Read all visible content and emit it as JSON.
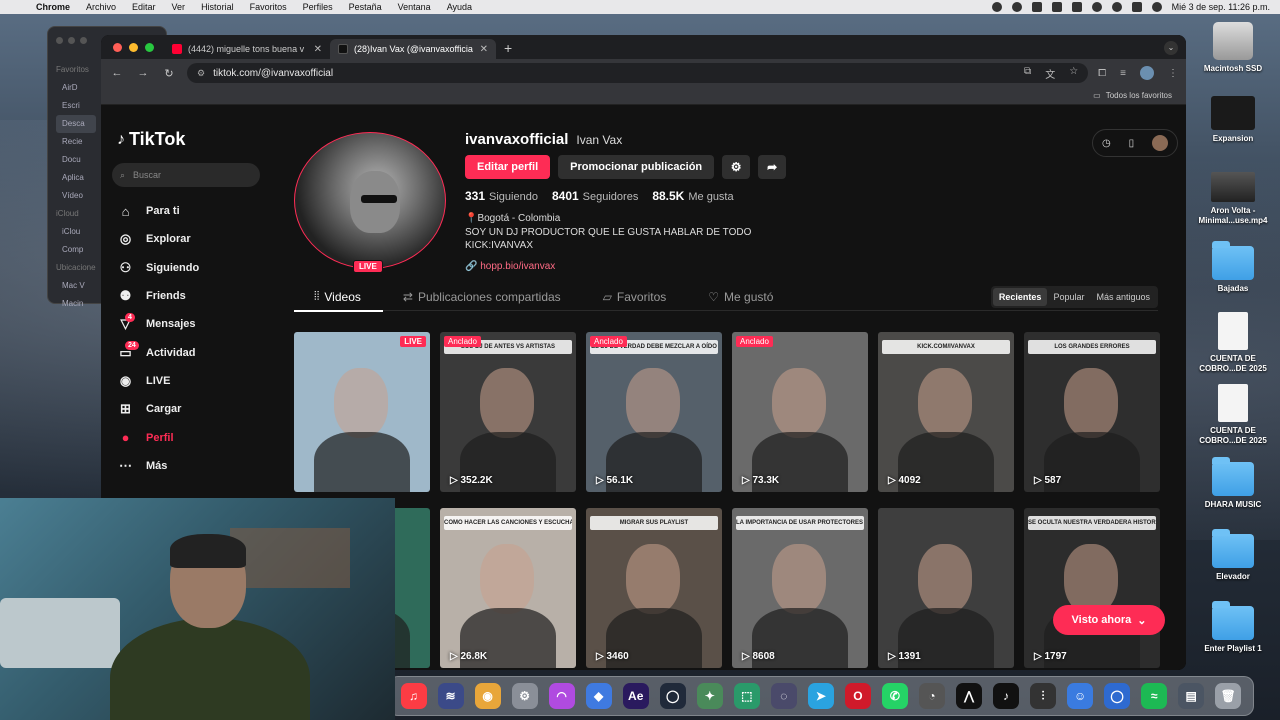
{
  "menubar": {
    "app": "Chrome",
    "items": [
      "Archivo",
      "Editar",
      "Ver",
      "Historial",
      "Favoritos",
      "Perfiles",
      "Pestaña",
      "Ventana",
      "Ayuda"
    ],
    "clock": "Mié 3 de sep.  11:26 p.m."
  },
  "finder": {
    "sections": [
      {
        "title": "Favoritos",
        "items": [
          "AirD",
          "Escri",
          "Desca",
          "Recie",
          "Docu",
          "Aplica",
          "Vídeo"
        ]
      },
      {
        "title": "iCloud",
        "items": [
          "iClou",
          "Comp"
        ]
      },
      {
        "title": "Ubicacione",
        "items": [
          "Mac V",
          "Macin"
        ]
      }
    ]
  },
  "browser": {
    "tabs": [
      {
        "title": "(4442) miguelle tons buena v",
        "favicon_color": "#ff0033"
      },
      {
        "title": "(28)Ivan Vax (@ivanvaxofficia",
        "favicon_color": "#111111"
      }
    ],
    "url": "tiktok.com/@ivanvaxofficial",
    "bookmarks_label": "Todos los favoritos"
  },
  "tiktok": {
    "logo": "TikTok",
    "search_placeholder": "Buscar",
    "nav": [
      {
        "label": "Para ti",
        "icon": "⌂",
        "name": "home-icon"
      },
      {
        "label": "Explorar",
        "icon": "◎",
        "name": "compass-icon"
      },
      {
        "label": "Siguiendo",
        "icon": "👤",
        "name": "following-icon"
      },
      {
        "label": "Friends",
        "icon": "👥",
        "name": "friends-icon"
      },
      {
        "label": "Mensajes",
        "icon": "▽",
        "name": "messages-icon",
        "badge": "4"
      },
      {
        "label": "Actividad",
        "icon": "▭",
        "name": "activity-icon",
        "badge": "24"
      },
      {
        "label": "LIVE",
        "icon": "●",
        "name": "live-icon"
      },
      {
        "label": "Cargar",
        "icon": "⊞",
        "name": "upload-icon"
      },
      {
        "label": "Perfil",
        "icon": "◉",
        "name": "profile-icon",
        "active": true
      },
      {
        "label": "Más",
        "icon": "⋯",
        "name": "more-icon"
      }
    ],
    "profile": {
      "handle": "ivanvaxofficial",
      "display_name": "Ivan Vax",
      "live_badge": "LIVE",
      "edit_button": "Editar perfil",
      "promote_button": "Promocionar publicación",
      "stats": {
        "following": "331",
        "following_label": "Siguiendo",
        "followers": "8401",
        "followers_label": "Seguidores",
        "likes": "88.5K",
        "likes_label": "Me gusta"
      },
      "bio_line1": "📍Bogotá - Colombia",
      "bio_line2": "SOY UN DJ PRODUCTOR QUE LE GUSTA HABLAR DE TODO",
      "bio_line3": "KICK:IVANVAX",
      "link": "hopp.bio/ivanvax"
    },
    "tabs": {
      "videos": "Videos",
      "reposts": "Publicaciones compartidas",
      "favorites": "Favoritos",
      "liked": "Me gustó"
    },
    "sort": {
      "recent": "Recientes",
      "popular": "Popular",
      "oldest": "Más antiguos"
    },
    "videos": [
      {
        "tag": "LIVE",
        "tag_kind": "live",
        "views": "",
        "caption": "",
        "bg": "#9fb8c9"
      },
      {
        "tag": "Anclado",
        "tag_kind": "pin",
        "views": "352.2K",
        "caption": "LOS DJ DE ANTES VS ARTISTAS",
        "bg": "#3a3a3a"
      },
      {
        "tag": "Anclado",
        "tag_kind": "pin",
        "views": "56.1K",
        "caption": "EL DJ DE VERDAD DEBE MEZCLAR A OÍDO",
        "bg": "#55606a"
      },
      {
        "tag": "Anclado",
        "tag_kind": "pin",
        "views": "73.3K",
        "caption": "",
        "bg": "#6a6a6a"
      },
      {
        "tag": "",
        "tag_kind": "",
        "views": "4092",
        "caption": "KICK.COM/IVANVAX",
        "bg": "#4b4a48"
      },
      {
        "tag": "",
        "tag_kind": "",
        "views": "587",
        "caption": "LOS GRANDES ERRORES",
        "bg": "#2e2e2e"
      },
      {
        "tag": "",
        "tag_kind": "",
        "views": "",
        "caption": "",
        "bg": "#2f6b5a"
      },
      {
        "tag": "",
        "tag_kind": "",
        "views": "26.8K",
        "caption": "COMO HACER LAS CANCIONES Y ESCUCHARLAS",
        "bg": "#b8b0a8"
      },
      {
        "tag": "",
        "tag_kind": "",
        "views": "3460",
        "caption": "MIGRAR SUS PLAYLIST",
        "bg": "#5a5048"
      },
      {
        "tag": "",
        "tag_kind": "",
        "views": "8608",
        "caption": "LA IMPORTANCIA DE USAR PROTECTORES AUDITIVOS",
        "bg": "#6a6a6a"
      },
      {
        "tag": "",
        "tag_kind": "",
        "views": "1391",
        "caption": "",
        "bg": "#3e3e3e"
      },
      {
        "tag": "",
        "tag_kind": "",
        "views": "1797",
        "caption": "SE OCULTA NUESTRA VERDADERA HISTORIA",
        "bg": "#2c2c2c"
      }
    ],
    "visto_ahora": "Visto ahora"
  },
  "desktop_icons": [
    {
      "label": "Macintosh SSD",
      "kind": "drive"
    },
    {
      "label": "Expansion",
      "kind": "ext"
    },
    {
      "label": "Aron Volta - Minimal...use.mp4",
      "kind": "thumb"
    },
    {
      "label": "Bajadas",
      "kind": "folder"
    },
    {
      "label": "CUENTA DE COBRO...DE 2025",
      "kind": "doc"
    },
    {
      "label": "CUENTA DE COBRO...DE 2025",
      "kind": "doc"
    },
    {
      "label": "DHARA MUSIC",
      "kind": "folder"
    },
    {
      "label": "Elevador",
      "kind": "folder"
    },
    {
      "label": "Enter Playlist 1",
      "kind": "folder"
    }
  ],
  "dock": [
    {
      "name": "music-app",
      "color": "#fc3c44",
      "glyph": "♫"
    },
    {
      "name": "voice-app",
      "color": "#3b4a88",
      "glyph": "≋"
    },
    {
      "name": "chrome-app",
      "color": "#e8a63a",
      "glyph": "◉"
    },
    {
      "name": "settings-app",
      "color": "#8a8f98",
      "glyph": "⚙"
    },
    {
      "name": "podcasts-app",
      "color": "#b04be0",
      "glyph": "◠"
    },
    {
      "name": "utility-app",
      "color": "#3f7ae0",
      "glyph": "◆"
    },
    {
      "name": "aftereffects-app",
      "color": "#2a1a5e",
      "glyph": "Ae"
    },
    {
      "name": "obs-app",
      "color": "#202a3a",
      "glyph": "◯"
    },
    {
      "name": "winrar-app",
      "color": "#4a8a5a",
      "glyph": "✦"
    },
    {
      "name": "android-app",
      "color": "#2a9a6a",
      "glyph": "⬚"
    },
    {
      "name": "vpn-app",
      "color": "#4a4a6a",
      "glyph": "◌"
    },
    {
      "name": "telegram-app",
      "color": "#2aa3e0",
      "glyph": "➤"
    },
    {
      "name": "opera-app",
      "color": "#d01a2a",
      "glyph": "O"
    },
    {
      "name": "whatsapp-app",
      "color": "#25d366",
      "glyph": "✆"
    },
    {
      "name": "activity-app",
      "color": "#555",
      "glyph": "◔"
    },
    {
      "name": "capcut-app",
      "color": "#111",
      "glyph": "⋀"
    },
    {
      "name": "tiktok-app",
      "color": "#111",
      "glyph": "♪"
    },
    {
      "name": "mixer-app",
      "color": "#333",
      "glyph": "⫶"
    },
    {
      "name": "finder-app",
      "color": "#3a7be0",
      "glyph": "☺"
    },
    {
      "name": "obs2-app",
      "color": "#2e6ad0",
      "glyph": "◯"
    },
    {
      "name": "spotify-app",
      "color": "#1db954",
      "glyph": "≈"
    },
    {
      "name": "folder-app",
      "color": "#4b5563",
      "glyph": "▤"
    },
    {
      "name": "trash-app",
      "color": "#9aa0a8",
      "glyph": "🗑"
    }
  ]
}
